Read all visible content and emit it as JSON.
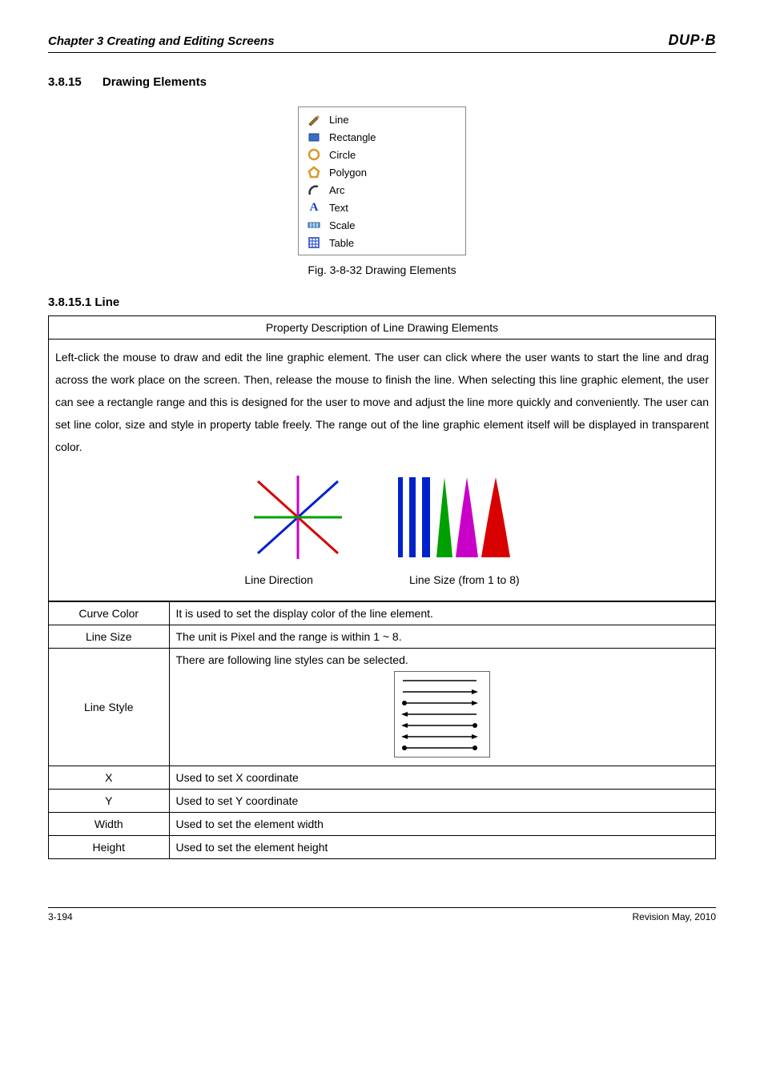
{
  "header": {
    "chapter": "Chapter 3 Creating and Editing Screens",
    "logo": "DUP·B"
  },
  "section": {
    "number": "3.8.15",
    "title": "Drawing Elements"
  },
  "menu": {
    "items": [
      {
        "label": "Line"
      },
      {
        "label": "Rectangle"
      },
      {
        "label": "Circle"
      },
      {
        "label": "Polygon"
      },
      {
        "label": "Arc"
      },
      {
        "label": "Text"
      },
      {
        "label": "Scale"
      },
      {
        "label": "Table"
      }
    ]
  },
  "fig_caption": "Fig. 3-8-32 Drawing Elements",
  "subsection": {
    "number": "3.8.15.1",
    "title": "Line"
  },
  "property_box": {
    "title": "Property Description of Line Drawing Elements",
    "description": "Left-click the mouse to draw and edit the line graphic element. The user can click where the user wants to start the line and drag across the work place on the screen. Then, release the mouse to finish the line. When selecting this line graphic element, the user can see a rectangle range and this is designed for the user to move and adjust the line more quickly and conveniently. The user can set line color, size and style in property table freely. The range out of the line graphic element itself will be displayed in transparent color.",
    "illus_captions": {
      "left": "Line Direction",
      "right": "Line Size (from 1 to 8)"
    },
    "rows": {
      "curve_color": {
        "label": "Curve Color",
        "value": "It is used to set the display color of the line element."
      },
      "line_size": {
        "label": "Line Size",
        "value": "The unit is Pixel and the range is within 1 ~ 8."
      },
      "line_style": {
        "label": "Line Style",
        "value": "There are following line styles can be selected."
      },
      "x": {
        "label": "X",
        "value": "Used to set X coordinate"
      },
      "y": {
        "label": "Y",
        "value": "Used to set Y coordinate"
      },
      "width": {
        "label": "Width",
        "value": "Used to set the element width"
      },
      "height": {
        "label": "Height",
        "value": "Used to set the element height"
      }
    }
  },
  "footer": {
    "page": "3-194",
    "revision": "Revision May, 2010"
  }
}
